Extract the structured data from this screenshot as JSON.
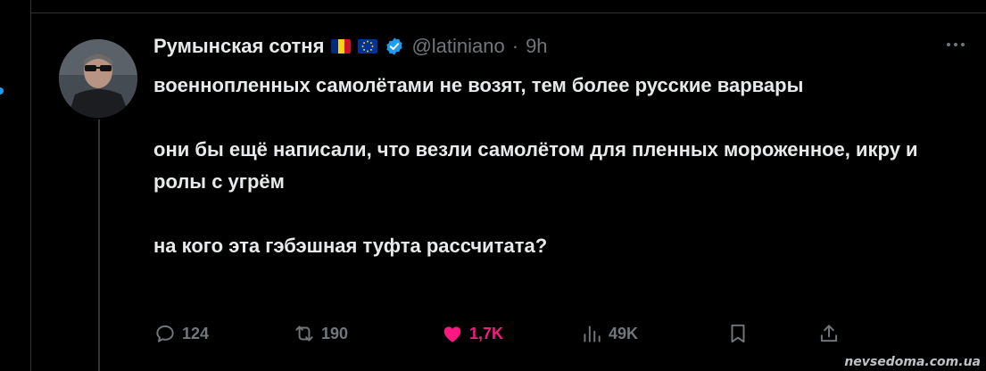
{
  "tweet": {
    "author": {
      "name": "Румынская сотня",
      "handle": "@latiniano",
      "separator": "·",
      "time": "9h"
    },
    "lines": [
      "военнопленных самолётами не возят, тем более русские варвары",
      "они бы ещё написали, что везли самолётом для пленных мороженное, икру и ролы с угрём",
      "на кого эта гэбэшная туфта рассчитата?"
    ],
    "actions": {
      "replies": "124",
      "reposts": "190",
      "likes": "1,7K",
      "views": "49K"
    }
  },
  "watermark": "nevsedoma.com.ua",
  "colors": {
    "background": "#000000",
    "text": "#e7e9ea",
    "muted": "#71767b",
    "like": "#f91880",
    "verified": "#1d9bf0"
  },
  "icons": [
    "romania-flag-icon",
    "eu-flag-icon",
    "verified-badge-icon",
    "more-icon",
    "reply-icon",
    "repost-icon",
    "like-icon",
    "views-icon",
    "bookmark-icon",
    "share-icon"
  ]
}
